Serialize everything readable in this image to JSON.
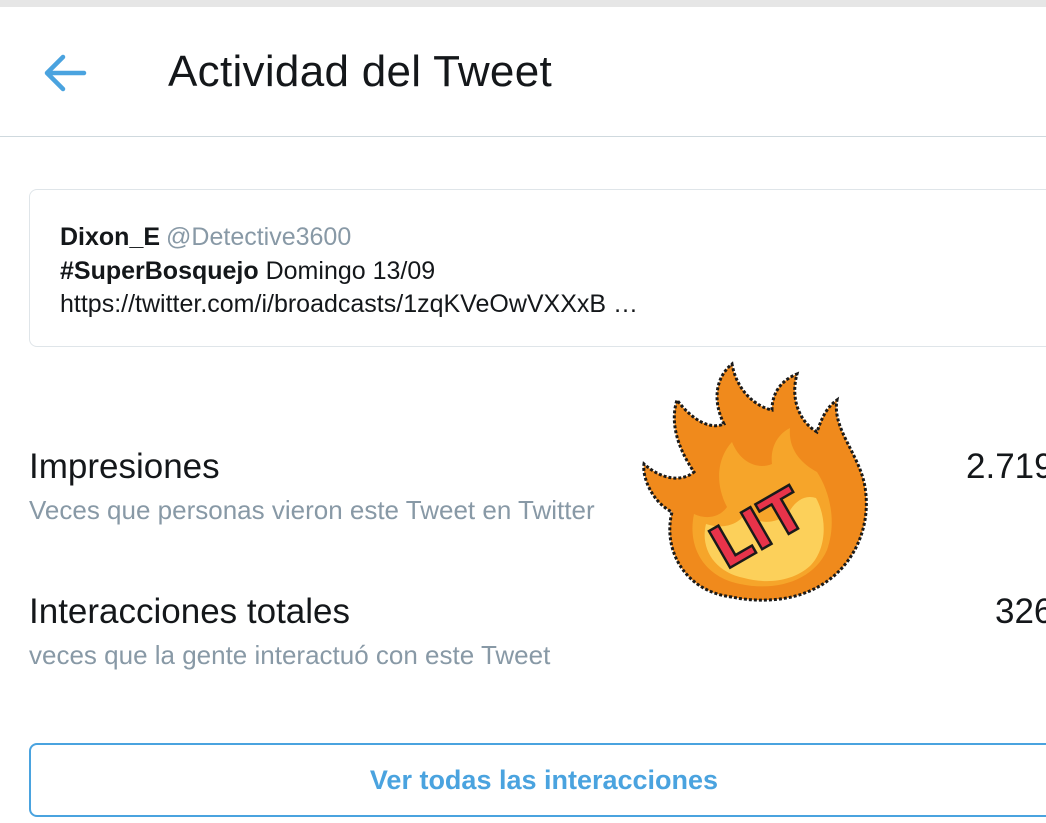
{
  "header": {
    "title": "Actividad del Tweet",
    "back_icon": "arrow-left-icon"
  },
  "tweet": {
    "author_name": "Dixon_E",
    "author_handle": "@Detective3600",
    "hashtag": "#SuperBosquejo",
    "text_after_hashtag": " Domingo 13/09",
    "link": "https://twitter.com/i/broadcasts/1zqKVeOwVXXxB …"
  },
  "metrics": [
    {
      "title": "Impresiones",
      "description": "Veces que personas vieron este Tweet en Twitter",
      "value": "2.719"
    },
    {
      "title": "Interacciones totales",
      "description": "veces que la gente interactuó con este Tweet",
      "value": "326"
    }
  ],
  "actions": {
    "view_all_label": "Ver todas las interacciones"
  },
  "sticker": {
    "text": "LIT",
    "icon": "fire-sticker-icon"
  },
  "colors": {
    "accent": "#4aa3df",
    "secondary_text": "#8899a6",
    "primary_text": "#14171a",
    "sticker_flame": "#f08a1c",
    "sticker_core": "#fcd05a",
    "sticker_text": "#e8334a"
  }
}
